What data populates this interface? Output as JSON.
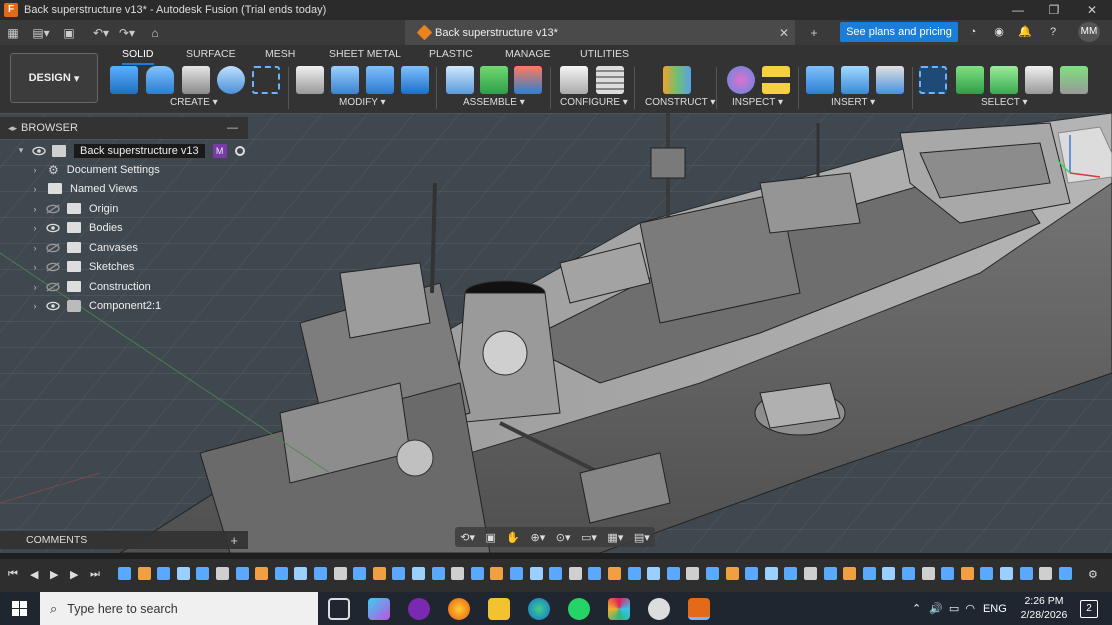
{
  "window": {
    "title": "Back superstructure v13* - Autodesk Fusion (Trial ends today)",
    "app_icon": "F"
  },
  "tabs": {
    "document_tab": "Back superstructure v13*",
    "plans_button": "See plans and pricing",
    "user_initials": "MM"
  },
  "ribbon": {
    "workspace_button": "DESIGN",
    "workspace_tabs": [
      "SOLID",
      "SURFACE",
      "MESH",
      "SHEET METAL",
      "PLASTIC",
      "MANAGE",
      "UTILITIES"
    ],
    "groups": [
      "CREATE",
      "MODIFY",
      "ASSEMBLE",
      "CONFIGURE",
      "CONSTRUCT",
      "INSPECT",
      "INSERT",
      "SELECT"
    ]
  },
  "browser": {
    "header": "BROWSER",
    "root": "Back superstructure v13",
    "items": [
      "Document Settings",
      "Named Views",
      "Origin",
      "Bodies",
      "Canvases",
      "Sketches",
      "Construction",
      "Component2:1"
    ]
  },
  "comments": {
    "label": "COMMENTS"
  },
  "taskbar": {
    "search_placeholder": "Type here to search",
    "language": "ENG",
    "time": "2:26 PM",
    "date": "2/28/2026",
    "notifications": "2"
  },
  "colors": {
    "accent": "#1a7ed8",
    "brand_orange": "#e8831f",
    "viewport_bg": "#40484f",
    "model_gray": "#8a8a8a"
  }
}
